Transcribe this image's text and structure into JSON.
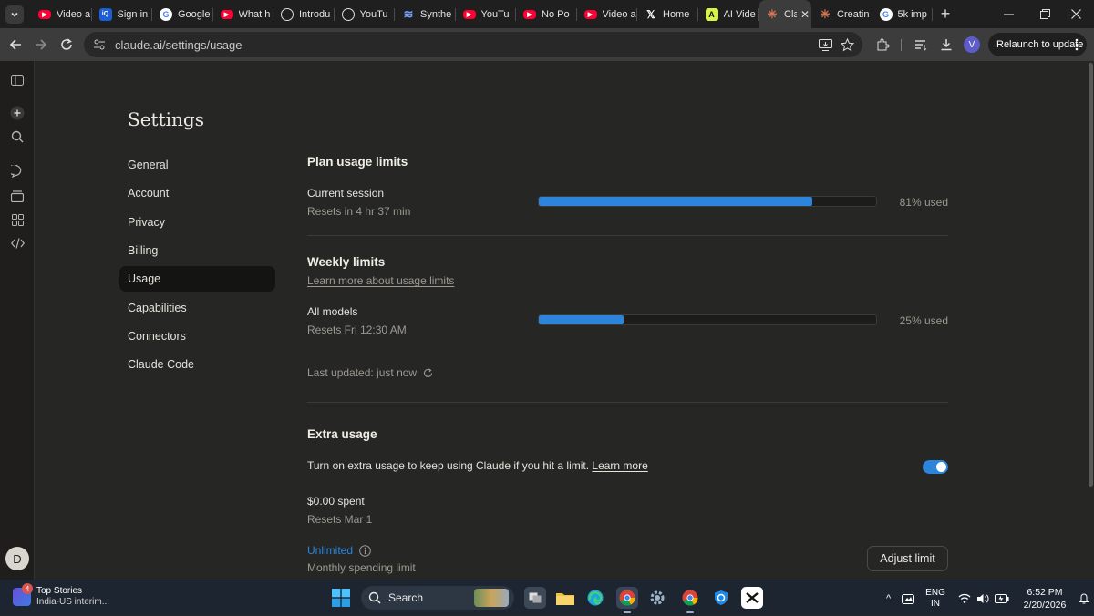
{
  "browser": {
    "tabs": [
      {
        "title": "Video a",
        "favicon": "youtube-icon",
        "color": "#ff0033"
      },
      {
        "title": "Sign in",
        "favicon": "iq-icon",
        "color": "#1a5fd9"
      },
      {
        "title": "Google",
        "favicon": "google-icon",
        "color": "#ffffff"
      },
      {
        "title": "What h",
        "favicon": "youtube-icon",
        "color": "#ff0033"
      },
      {
        "title": "Introdu",
        "favicon": "introducing-icon",
        "color": "#ffffff"
      },
      {
        "title": "YouTu",
        "favicon": "chatgpt-icon",
        "color": "#ffffff"
      },
      {
        "title": "Synthe",
        "favicon": "synthesia-icon",
        "color": "#7aa2ff"
      },
      {
        "title": "YouTu",
        "favicon": "youtube-icon",
        "color": "#ff0033"
      },
      {
        "title": "No Po",
        "favicon": "youtube-icon",
        "color": "#ff0033"
      },
      {
        "title": "Video a",
        "favicon": "youtube-icon",
        "color": "#ff0033"
      },
      {
        "title": "Home",
        "favicon": "x-icon",
        "color": "#ffffff"
      },
      {
        "title": "AI Vide",
        "favicon": "ai-video-icon",
        "color": "#d8f24a"
      },
      {
        "title": "Cla",
        "favicon": "claude-icon",
        "color": "#d97757",
        "active": true
      },
      {
        "title": "Creatin",
        "favicon": "claude-icon",
        "color": "#d97757"
      },
      {
        "title": "5k imp",
        "favicon": "google-icon",
        "color": "#ffffff"
      }
    ],
    "url": "claude.ai/settings/usage",
    "relaunch_label": "Relaunch to update",
    "profile_initial": "V"
  },
  "rail": {
    "avatar_initial": "D"
  },
  "settings": {
    "title": "Settings",
    "nav": [
      {
        "label": "General"
      },
      {
        "label": "Account"
      },
      {
        "label": "Privacy"
      },
      {
        "label": "Billing"
      },
      {
        "label": "Usage",
        "active": true
      },
      {
        "label": "Capabilities"
      },
      {
        "label": "Connectors"
      },
      {
        "label": "Claude Code"
      }
    ]
  },
  "usage": {
    "plan_heading": "Plan usage limits",
    "session": {
      "label": "Current session",
      "reset": "Resets in 4 hr 37 min",
      "used_text": "81% used",
      "percent": 81
    },
    "weekly_heading": "Weekly limits",
    "weekly_link": "Learn more about usage limits",
    "all_models": {
      "label": "All models",
      "reset": "Resets Fri 12:30 AM",
      "used_text": "25% used",
      "percent": 25
    },
    "last_updated": "Last updated: just now",
    "extra_heading": "Extra usage",
    "extra_desc": "Turn on extra usage to keep using Claude if you hit a limit.",
    "extra_link": "Learn more",
    "extra_enabled": true,
    "spent": "$0.00 spent",
    "spent_reset": "Resets Mar 1",
    "limit_value": "Unlimited",
    "limit_desc": "Monthly spending limit",
    "adjust_label": "Adjust limit",
    "accent": "#2c84db"
  },
  "taskbar": {
    "news_title": "Top Stories",
    "news_sub": "India-US interim...",
    "news_badge": "4",
    "search_label": "Search",
    "lang_top": "ENG",
    "lang_bottom": "IN",
    "time": "6:52 PM",
    "date": "2/20/2026"
  }
}
